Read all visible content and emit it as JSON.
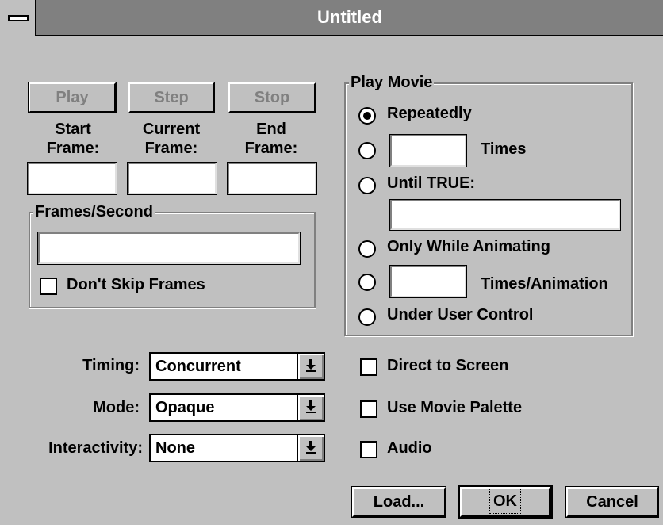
{
  "window": {
    "title": "Untitled"
  },
  "transport": {
    "play": "Play",
    "step": "Step",
    "stop": "Stop"
  },
  "frames": {
    "start_line1": "Start",
    "start_line2": "Frame:",
    "current_line1": "Current",
    "current_line2": "Frame:",
    "end_line1": "End",
    "end_line2": "Frame:",
    "start_value": "",
    "current_value": "",
    "end_value": ""
  },
  "fps": {
    "legend": "Frames/Second",
    "value": "",
    "dont_skip": "Don't Skip Frames",
    "dont_skip_checked": false
  },
  "play_movie": {
    "legend": "Play Movie",
    "repeatedly": "Repeatedly",
    "times": "Times",
    "until_true": "Until TRUE:",
    "only_animating": "Only While Animating",
    "times_animation": "Times/Animation",
    "user_control": "Under User Control",
    "selected": "repeatedly",
    "times_value": "",
    "until_value": "",
    "times_anim_value": ""
  },
  "options": {
    "timing_label": "Timing:",
    "timing_value": "Concurrent",
    "mode_label": "Mode:",
    "mode_value": "Opaque",
    "interactivity_label": "Interactivity:",
    "interactivity_value": "None"
  },
  "checkboxes": {
    "direct_to_screen": "Direct to Screen",
    "use_movie_palette": "Use Movie Palette",
    "audio": "Audio"
  },
  "buttons": {
    "load": "Load...",
    "ok": "OK",
    "cancel": "Cancel"
  }
}
